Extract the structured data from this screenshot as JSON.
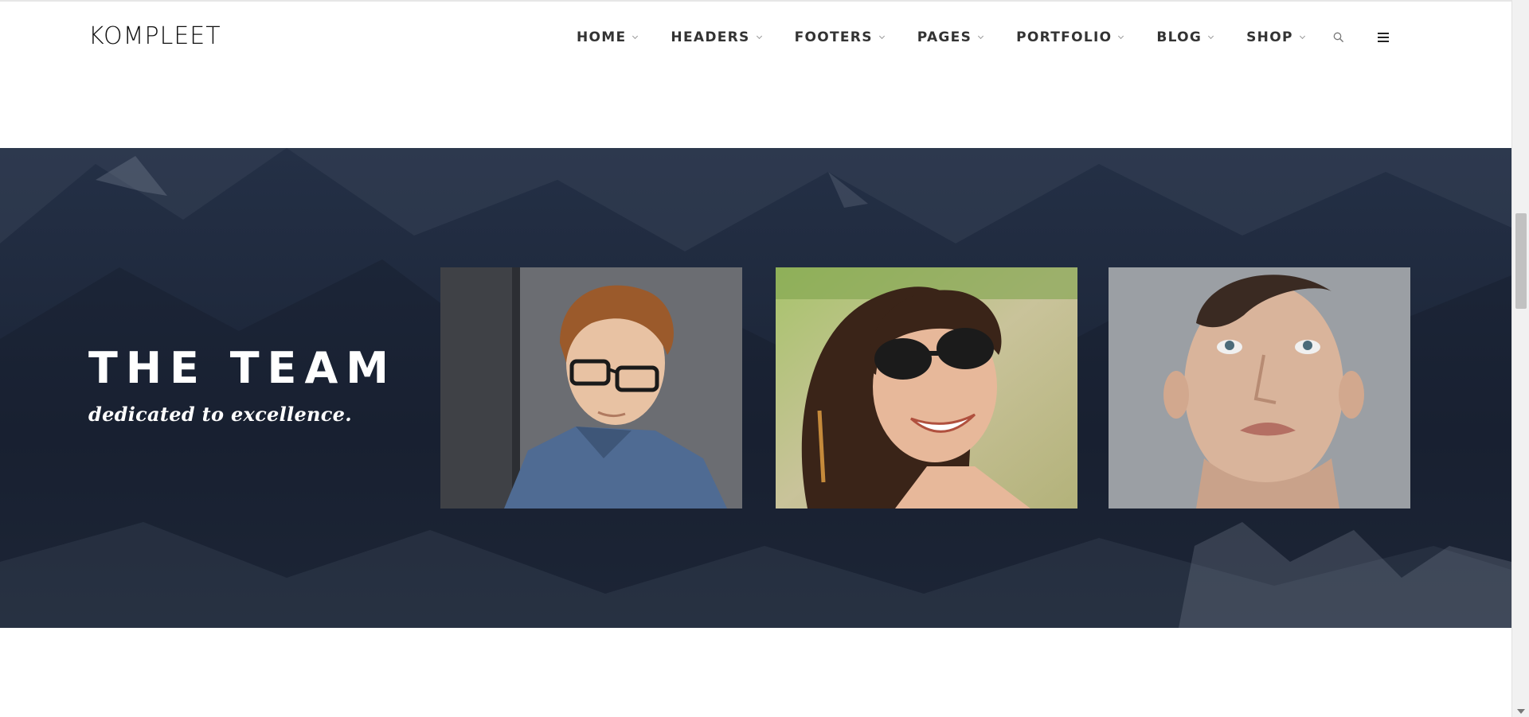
{
  "brand": {
    "logo_text": "KOMPLEET"
  },
  "nav": {
    "items": [
      {
        "label": "HOME"
      },
      {
        "label": "HEADERS"
      },
      {
        "label": "FOOTERS"
      },
      {
        "label": "PAGES"
      },
      {
        "label": "PORTFOLIO"
      },
      {
        "label": "BLOG"
      },
      {
        "label": "SHOP"
      }
    ],
    "icons": [
      "search-icon",
      "menu-icon"
    ]
  },
  "team": {
    "title": "THE TEAM",
    "subtitle": "dedicated to excellence."
  },
  "colors": {
    "band": "#1d2637",
    "text_dark": "#333333"
  }
}
